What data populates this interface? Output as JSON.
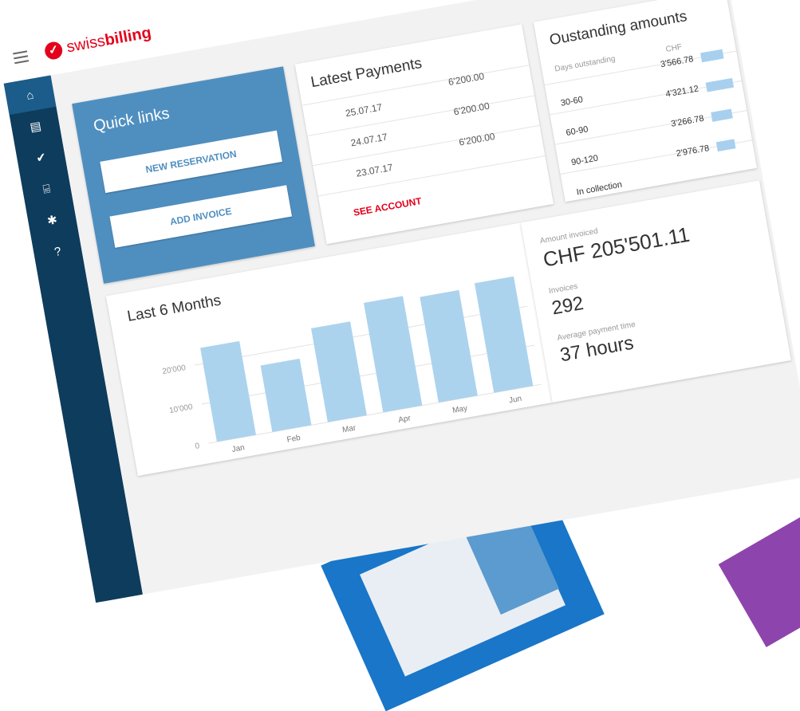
{
  "app": {
    "logo_prefix": "swiss",
    "logo_suffix": "billing"
  },
  "sidebar": {
    "items": [
      {
        "name": "home",
        "glyph": "⌂"
      },
      {
        "name": "document",
        "glyph": "▤"
      },
      {
        "name": "check",
        "glyph": "✔"
      },
      {
        "name": "bank",
        "glyph": "⌸"
      },
      {
        "name": "settings",
        "glyph": "✱"
      },
      {
        "name": "help",
        "glyph": "?"
      }
    ]
  },
  "quick_links": {
    "title": "Quick links",
    "buttons": [
      "NEW RESERVATION",
      "ADD INVOICE"
    ]
  },
  "payments": {
    "title": "Latest Payments",
    "rows": [
      {
        "date": "25.07.17",
        "amount": "6'200.00"
      },
      {
        "date": "24.07.17",
        "amount": "6'200.00"
      },
      {
        "date": "23.07.17",
        "amount": "6'200.00"
      }
    ],
    "link": "SEE ACCOUNT"
  },
  "outstanding": {
    "title": "Oustanding amounts",
    "col1": "Days outstanding",
    "col2": "CHF",
    "rows": [
      {
        "label": "30-60",
        "value": "3'566.78",
        "bar": 3566.78
      },
      {
        "label": "60-90",
        "value": "4'321.12",
        "bar": 4321.12
      },
      {
        "label": "90-120",
        "value": "3'266.78",
        "bar": 3266.78
      },
      {
        "label": "In collection",
        "value": "2'976.78",
        "bar": 2976.78
      }
    ]
  },
  "stats": {
    "amount_label": "Amount invoiced",
    "amount_value": "CHF 205'501.11",
    "invoices_label": "Invoices",
    "invoices_value": "292",
    "avg_label": "Average payment time",
    "avg_value": "37 hours"
  },
  "chart_data": {
    "type": "bar",
    "title": "Last 6 Months",
    "categories": [
      "Jan",
      "Feb",
      "Mar",
      "Apr",
      "May",
      "Jun"
    ],
    "values": [
      24000,
      17000,
      24000,
      28000,
      27000,
      28000
    ],
    "ylim": [
      0,
      30000
    ],
    "yticks": [
      0,
      10000,
      20000
    ],
    "ytick_labels": [
      "0",
      "10'000",
      "20'000"
    ],
    "bar_color": "#abd3ee"
  },
  "colors": {
    "brand": "#e4001b",
    "sidebar": "#0e3c5c",
    "quick": "#4f8fc0"
  }
}
